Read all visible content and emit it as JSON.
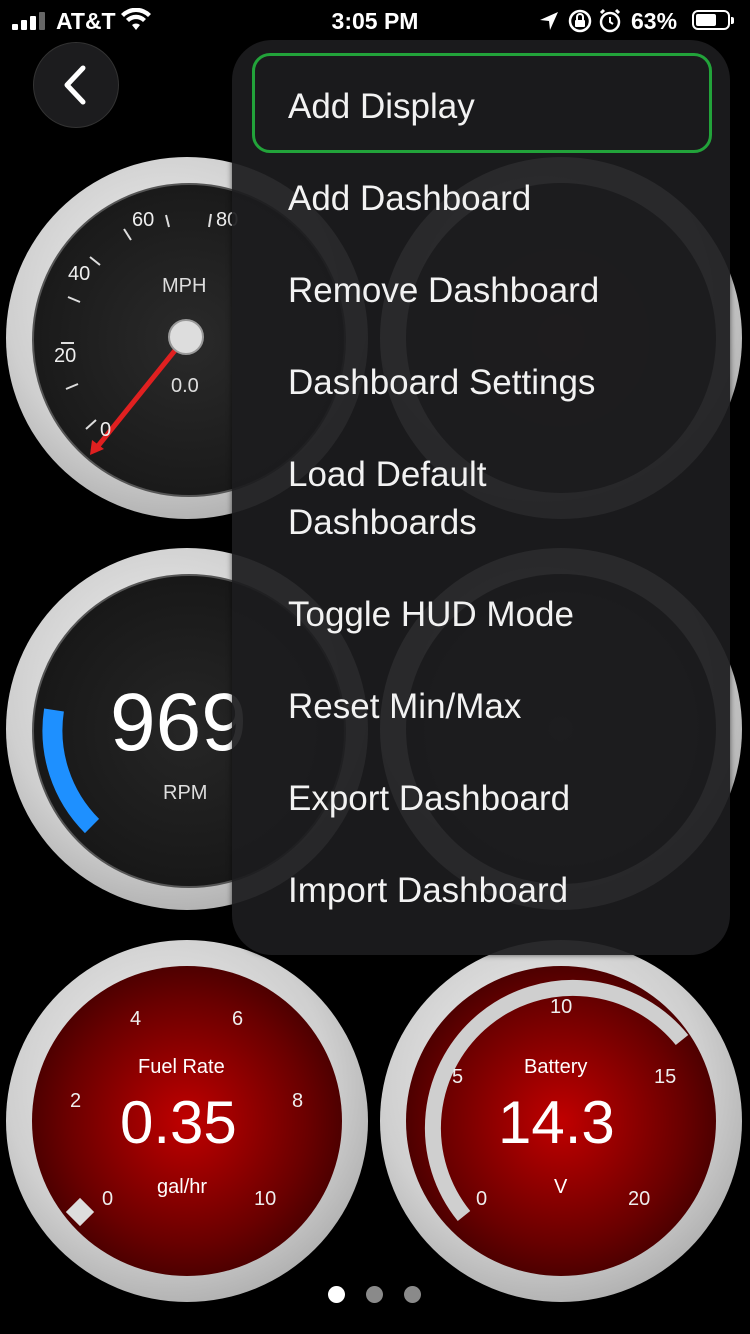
{
  "status_bar": {
    "carrier": "AT&T",
    "time": "3:05 PM",
    "battery_percent": "63%"
  },
  "gauges": {
    "speed": {
      "unit_label": "MPH",
      "value": "0.0",
      "ticks": [
        "0",
        "20",
        "40",
        "60",
        "80"
      ]
    },
    "rpm": {
      "value": "969",
      "unit_label": "RPM"
    },
    "fuel_rate": {
      "title": "Fuel Rate",
      "value": "0.35",
      "unit": "gal/hr",
      "ticks": [
        "0",
        "2",
        "4",
        "6",
        "8",
        "10"
      ]
    },
    "battery": {
      "title": "Battery",
      "value": "14.3",
      "unit": "V",
      "ticks": [
        "0",
        "5",
        "10",
        "15",
        "20"
      ]
    }
  },
  "menu": {
    "items": [
      "Add Display",
      "Add Dashboard",
      "Remove Dashboard",
      "Dashboard Settings",
      "Load Default",
      "Dashboards",
      "Toggle HUD Mode",
      "Reset Min/Max",
      "Export Dashboard",
      "Import Dashboard"
    ],
    "selected_index": 0
  },
  "page_indicator": {
    "count": 3,
    "current": 0
  },
  "colors": {
    "accent": "#22a33a",
    "rpm_arc": "#1e90ff",
    "gauge_red": "#c00000"
  }
}
